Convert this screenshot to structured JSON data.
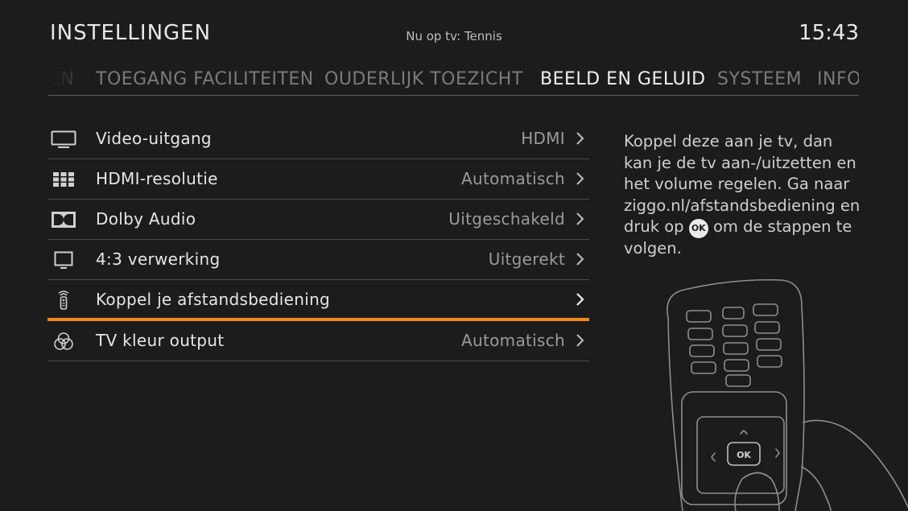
{
  "header": {
    "title": "INSTELLINGEN",
    "now_on_tv": "Nu op tv: Tennis",
    "clock": "15:43"
  },
  "tabs": [
    {
      "label": "EN",
      "state": "partial"
    },
    {
      "label": "TOEGANG FACILITEITEN",
      "state": "inactive"
    },
    {
      "label": "OUDERLIJK TOEZICHT",
      "state": "inactive"
    },
    {
      "label": "BEELD EN GELUID",
      "state": "active"
    },
    {
      "label": "SYSTEEM",
      "state": "inactive"
    },
    {
      "label": "INFO",
      "state": "inactive"
    }
  ],
  "menu": {
    "items": [
      {
        "icon": "tv-icon",
        "label": "Video-uitgang",
        "value": "HDMI"
      },
      {
        "icon": "grid-icon",
        "label": "HDMI-resolutie",
        "value": "Automatisch"
      },
      {
        "icon": "dolby-icon",
        "label": "Dolby Audio",
        "value": "Uitgeschakeld"
      },
      {
        "icon": "screen-icon",
        "label": "4:3 verwerking",
        "value": "Uitgerekt"
      },
      {
        "icon": "remote-icon",
        "label": "Koppel je afstandsbediening",
        "value": "",
        "selected": true
      },
      {
        "icon": "color-circles-icon",
        "label": "TV kleur output",
        "value": "Automatisch"
      }
    ]
  },
  "help": {
    "text_before_ok": "Koppel deze aan je tv, dan kan je de tv aan-/uitzetten en het volume regelen. Ga naar ziggo.nl/afstandsbediening en druk op",
    "ok_label": "OK",
    "text_after_ok": "om de stappen te volgen."
  },
  "illustration": {
    "ok_button_label": "OK"
  },
  "colors": {
    "background": "#1c1c1c",
    "accent": "#f08a1c",
    "text_primary": "#e6e6e6",
    "text_secondary": "#9a9a9a"
  }
}
